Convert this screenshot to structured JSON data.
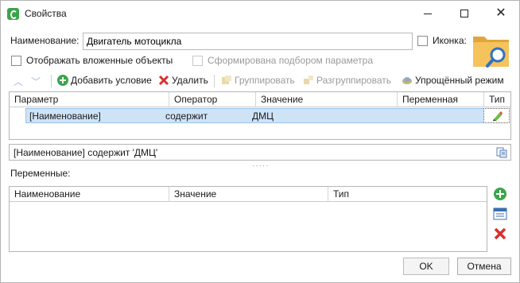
{
  "window": {
    "title": "Свойства",
    "controls": {
      "minimize": "—",
      "maximize": "☐",
      "close": "✕"
    }
  },
  "form": {
    "name_label": "Наименование:",
    "name_value": "Двигатель мотоцикла",
    "icon_label": "Иконка:",
    "show_nested_label": "Отображать вложенные объекты",
    "formed_by_param_label": "Сформирована подбором параметра"
  },
  "toolbar": {
    "up_label": "︿",
    "down_label": "﹀",
    "add_condition": "Добавить условие",
    "delete": "Удалить",
    "group": "Группировать",
    "ungroup": "Разгруппировать",
    "simple_mode": "Упрощённый режим"
  },
  "conditions_grid": {
    "columns": [
      "Параметр",
      "Оператор",
      "Значение",
      "Переменная",
      "Тип"
    ],
    "rows": [
      {
        "parameter": "[Наименование]",
        "operator": "содержит",
        "value": "ДМЦ",
        "variable": "",
        "type_icon": "pencil-icon"
      }
    ]
  },
  "expression": "[Наименование] содержит 'ДМЦ'",
  "splitter": "·····",
  "variables": {
    "label": "Переменные:",
    "columns": [
      "Наименование",
      "Значение",
      "Тип"
    ],
    "rows": []
  },
  "buttons": {
    "ok": "OK",
    "cancel": "Отмена"
  },
  "colors": {
    "accent_green": "#3aa54a",
    "selection": "#cfe3f7",
    "delete_red": "#d9302c",
    "folder": "#f0b64a"
  }
}
